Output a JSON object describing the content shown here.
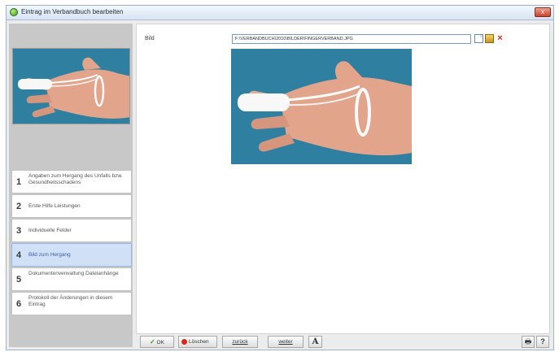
{
  "window": {
    "title": "Eintrag im Verbandbuch bearbeiten",
    "close_label": "x"
  },
  "sidebar": {
    "steps": [
      {
        "number": "1",
        "label": "Angaben zum Hergang des Unfalls bzw. Gesundheitsschadens"
      },
      {
        "number": "2",
        "label": "Erste Hilfe Leistungen"
      },
      {
        "number": "3",
        "label": "Individuelle Felder"
      },
      {
        "number": "4",
        "label": "Bild zum Hergang"
      },
      {
        "number": "5",
        "label": "Dokumentenverwaltung Dateianhänge"
      },
      {
        "number": "6",
        "label": "Protokoll der Änderungen in diesem Eintrag"
      }
    ],
    "active_step": 4
  },
  "main": {
    "field_label": "Bild",
    "path_value": "F:\\VERBANDBUCH\\2010\\BILDER\\FINGERVERBAND.JPG"
  },
  "toolbar": {
    "ok_check": "✓",
    "ok_label": "OK",
    "delete_label": "Löschen",
    "back_label": "zurück",
    "next_label": "weiter",
    "font_label": "A",
    "print_icon": "🖶",
    "help_label": "?"
  },
  "colors": {
    "photo_background": "#2f7fa0",
    "active_step": "#cfe0f7",
    "sidebar": "#c8c8c8"
  }
}
